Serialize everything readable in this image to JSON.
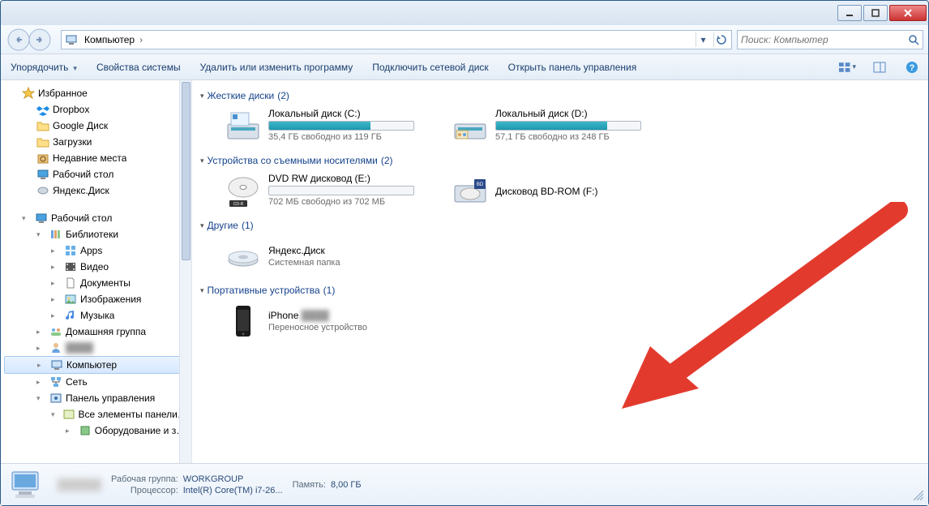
{
  "titlebar": {
    "min": "▁",
    "max": "▢",
    "close": "✕"
  },
  "nav": {
    "crumbs": [
      "Компьютер"
    ],
    "search_placeholder": "Поиск: Компьютер"
  },
  "toolbar": {
    "organize": "Упорядочить",
    "sysprops": "Свойства системы",
    "addremove": "Удалить или изменить программу",
    "mapdrive": "Подключить сетевой диск",
    "cpanel": "Открыть панель управления"
  },
  "sidebar": {
    "favorites_head": "Избранное",
    "favorites": [
      {
        "icon": "dropbox",
        "label": "Dropbox"
      },
      {
        "icon": "gdrive",
        "label": "Google Диск"
      },
      {
        "icon": "downloads",
        "label": "Загрузки"
      },
      {
        "icon": "recent",
        "label": "Недавние места"
      },
      {
        "icon": "desktop",
        "label": "Рабочий стол"
      },
      {
        "icon": "ydisk",
        "label": "Яндекс.Диск"
      }
    ],
    "desktop_head": "Рабочий стол",
    "libraries_head": "Библиотеки",
    "libraries": [
      {
        "icon": "apps",
        "label": "Apps"
      },
      {
        "icon": "videos",
        "label": "Видео"
      },
      {
        "icon": "docs",
        "label": "Документы"
      },
      {
        "icon": "pics",
        "label": "Изображения"
      },
      {
        "icon": "music",
        "label": "Музыка"
      }
    ],
    "homegroup": "Домашняя группа",
    "user_blur": "████",
    "computer": "Компьютер",
    "network": "Сеть",
    "cp": "Панель управления",
    "cp_all": "Все элементы панели управле",
    "cp_hw": "Оборудование и звук"
  },
  "main": {
    "sec_hdd": {
      "title": "Жесткие диски",
      "count": "(2)"
    },
    "drive_c": {
      "title": "Локальный диск (C:)",
      "sub": "35,4 ГБ свободно из 119 ГБ",
      "used_pct": 70
    },
    "drive_d": {
      "title": "Локальный диск (D:)",
      "sub": "57,1 ГБ свободно из 248 ГБ",
      "used_pct": 77
    },
    "sec_removable": {
      "title": "Устройства со съемными носителями",
      "count": "(2)"
    },
    "drive_e": {
      "title": "DVD RW дисковод (E:)",
      "sub": "702 МБ свободно из 702 МБ",
      "used_pct": 0
    },
    "drive_f": {
      "title": "Дисковод BD-ROM (F:)"
    },
    "sec_other": {
      "title": "Другие",
      "count": "(1)"
    },
    "ydisk": {
      "title": "Яндекс.Диск",
      "sub": "Системная папка"
    },
    "sec_portable": {
      "title": "Портативные устройства",
      "count": "(1)"
    },
    "iphone": {
      "title": "iPhone",
      "sub": "Переносное устройство"
    }
  },
  "status": {
    "wg_k": "Рабочая группа:",
    "wg_v": "WORKGROUP",
    "cpu_k": "Процессор:",
    "cpu_v": "Intel(R) Core(TM) i7-26...",
    "mem_k": "Память:",
    "mem_v": "8,00 ГБ"
  }
}
